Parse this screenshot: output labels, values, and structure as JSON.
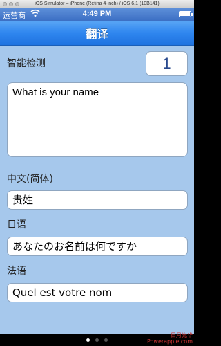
{
  "simulator": {
    "title": "iOS Simulator – iPhone (Retina 4-inch) / iOS 6.1 (10B141)"
  },
  "status_bar": {
    "carrier": "运营商",
    "time": "4:49 PM",
    "wifi_icon": "wifi-icon",
    "battery_icon": "battery-icon"
  },
  "nav": {
    "title": "翻译"
  },
  "detect": {
    "label": "智能检测",
    "count": "1"
  },
  "input": {
    "text": "What is your name"
  },
  "chinese": {
    "label": "中文(简体)",
    "value": "贵姓"
  },
  "japanese": {
    "label": "日语",
    "value": "あなたのお名前は何ですか"
  },
  "french": {
    "label": "法语",
    "value": "Quel est votre nom"
  },
  "page_control": {
    "pages": 3,
    "current": 1
  },
  "watermark": {
    "line1": "日月光华",
    "line2": "Powerapple.com"
  }
}
